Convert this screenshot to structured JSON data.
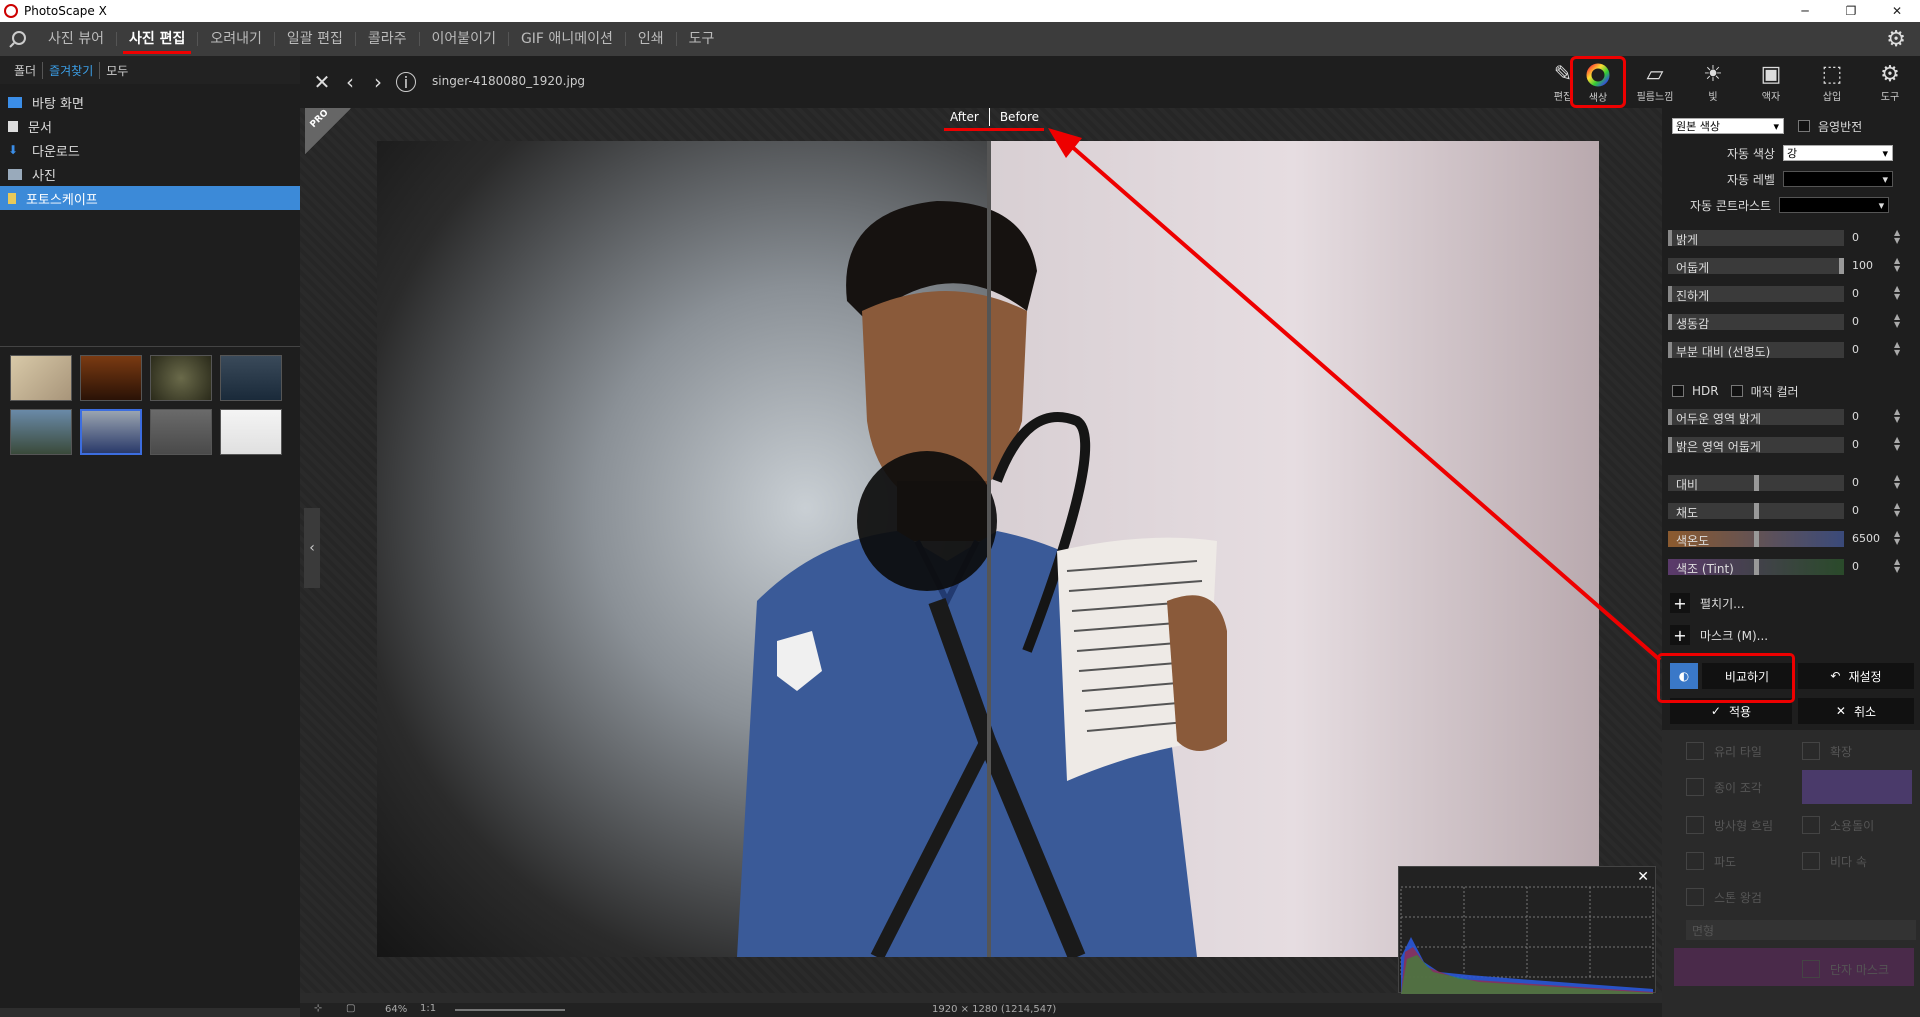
{
  "window": {
    "title": "PhotoScape X",
    "min": "─",
    "max": "❐",
    "close": "✕"
  },
  "menu": {
    "tabs": [
      "사진 뷰어",
      "사진 편집",
      "오려내기",
      "일괄 편집",
      "콜라주",
      "이어붙이기",
      "GIF 애니메이션",
      "인쇄",
      "도구"
    ],
    "active": "사진 편집"
  },
  "left": {
    "subtabs": [
      "폴더",
      "즐겨찾기",
      "모두"
    ],
    "tree": [
      "바탕 화면",
      "문서",
      "다운로드",
      "사진",
      "포토스케이프"
    ],
    "selected": "포토스케이프"
  },
  "viewer": {
    "filename": "singer-4180080_1920.jpg",
    "after_label": "After",
    "before_label": "Before",
    "pro": "PRO",
    "resolution": "1920 × 1280 (1214,547)",
    "zoom": "64%",
    "zoom_reset": "1:1"
  },
  "tools": [
    {
      "label": "편집",
      "icon": "✎"
    },
    {
      "label": "색상",
      "icon": "◎"
    },
    {
      "label": "필름느낌",
      "icon": "▱"
    },
    {
      "label": "빛",
      "icon": "☀"
    },
    {
      "label": "액자",
      "icon": "▣"
    },
    {
      "label": "삽입",
      "icon": "⬚"
    },
    {
      "label": "도구",
      "icon": "⚙"
    }
  ],
  "color_panel": {
    "source_dropdown": "원본 색상",
    "invert_label": "음영반전",
    "auto_color_label": "자동 색상",
    "auto_color_value": "강",
    "auto_level_label": "자동 레벨",
    "auto_contrast_label": "자동 콘트라스트",
    "sliders_a": [
      {
        "label": "밝게",
        "value": "0"
      },
      {
        "label": "어둡게",
        "value": "100"
      },
      {
        "label": "진하게",
        "value": "0"
      },
      {
        "label": "생동감",
        "value": "0"
      },
      {
        "label": "부분 대비 (선명도)",
        "value": "0"
      }
    ],
    "hdr_label": "HDR",
    "magic_label": "매직 컬러",
    "sliders_b": [
      {
        "label": "어두운 영역 밝게",
        "value": "0"
      },
      {
        "label": "밝은 영역 어둡게",
        "value": "0"
      }
    ],
    "sliders_c": [
      {
        "label": "대비",
        "value": "0"
      },
      {
        "label": "채도",
        "value": "0"
      },
      {
        "label": "색온도",
        "value": "6500"
      },
      {
        "label": "색조 (Tint)",
        "value": "0"
      }
    ],
    "expand_label": "펼치기...",
    "mask_label": "마스크 (M)...",
    "compare_label": "비교하기",
    "reset_label": "재설정",
    "apply_label": "적용",
    "cancel_label": "취소"
  },
  "bg_tools": [
    "유리 타일",
    "확장",
    "종이 조각",
    "방사형 흐림",
    "소용돌이",
    "파도",
    "비다 속",
    "스톤 왕검",
    "면형",
    "단자 마스크"
  ]
}
